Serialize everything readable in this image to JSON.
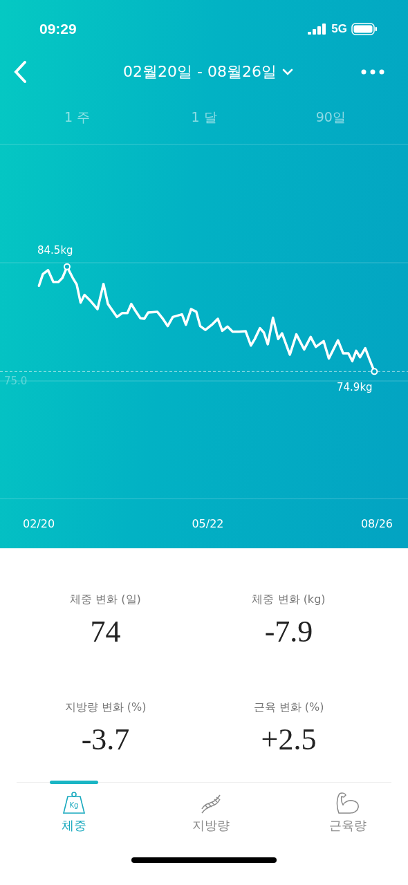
{
  "status_bar": {
    "time": "09:29",
    "network": "5G"
  },
  "header": {
    "date_range": "02월20일 - 08월26일"
  },
  "period_tabs": [
    {
      "label": "1 주",
      "selected": false
    },
    {
      "label": "1 달",
      "selected": false
    },
    {
      "label": "90일",
      "selected": false
    }
  ],
  "chart": {
    "max_label": "84.5kg",
    "end_label": "74.9kg",
    "baseline_label": "75.0",
    "x_labels": [
      "02/20",
      "05/22",
      "08/26"
    ]
  },
  "stats": [
    {
      "label": "체중 변화 (일)",
      "value": "74"
    },
    {
      "label": "체중 변화 (kg)",
      "value": "-7.9"
    },
    {
      "label": "지방량 변화 (%)",
      "value": "-3.7"
    },
    {
      "label": "근육 변화 (%)",
      "value": "+2.5"
    }
  ],
  "bottom_tabs": [
    {
      "kind": "weight",
      "label": "체중",
      "icon_text": "Kg",
      "selected": true
    },
    {
      "kind": "dna",
      "label": "지방량",
      "selected": false
    },
    {
      "kind": "muscle",
      "label": "근육량",
      "selected": false
    }
  ]
}
